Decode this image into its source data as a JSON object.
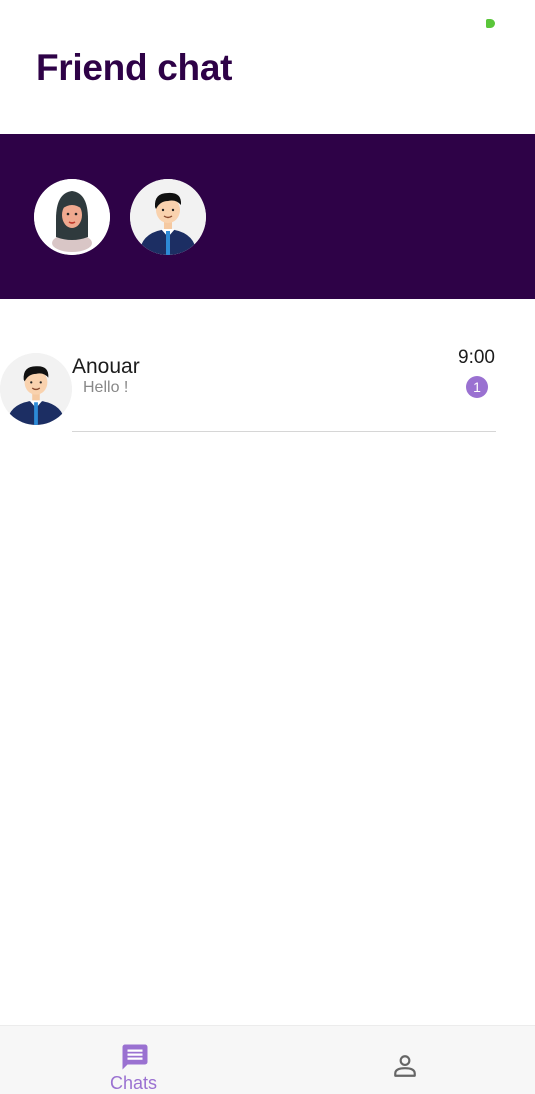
{
  "header": {
    "title": "Friend chat"
  },
  "status_bar": {
    "indicator_color": "#5ac63a"
  },
  "stories": {
    "background_color": "#2e0247",
    "avatars": [
      {
        "icon": "woman-hijab-avatar-icon"
      },
      {
        "icon": "man-suit-avatar-icon"
      }
    ]
  },
  "chats": [
    {
      "name": "Anouar",
      "preview": "Hello !",
      "time": "9:00",
      "unread": "1",
      "avatar": "man-suit-avatar-icon"
    }
  ],
  "bottom_nav": {
    "items": [
      {
        "label": "Chats",
        "icon": "chat-bubble-icon",
        "active": true
      },
      {
        "label": "",
        "icon": "person-icon",
        "active": false
      }
    ]
  },
  "colors": {
    "primary": "#2e0247",
    "accent": "#9a71d1"
  }
}
